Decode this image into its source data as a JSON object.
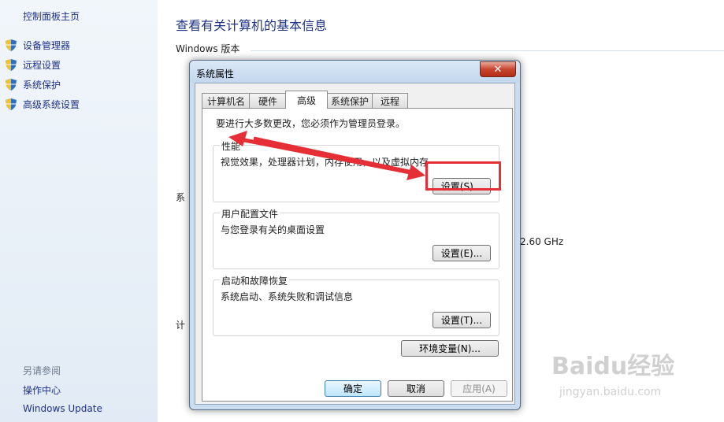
{
  "nav": {
    "home": "控制面板主页",
    "items": [
      {
        "label": "设备管理器"
      },
      {
        "label": "远程设置"
      },
      {
        "label": "系统保护"
      },
      {
        "label": "高级系统设置"
      }
    ],
    "see_also": "另请参阅",
    "links": [
      "操作中心",
      "Windows Update"
    ]
  },
  "main": {
    "title": "查看有关计算机的基本信息",
    "windows_version_heading": "Windows 版本",
    "peek_xi": "系",
    "peek_ji": "计",
    "peek_ghz": "2.60 GHz"
  },
  "dialog": {
    "title": "系统属性",
    "close": "✕",
    "tabs": [
      "计算机名",
      "硬件",
      "高级",
      "系统保护",
      "远程"
    ],
    "active_tab": "高级",
    "notice": "要进行大多数更改，您必须作为管理员登录。",
    "groups": [
      {
        "label": "性能",
        "desc": "视觉效果，处理器计划，内存使用，以及虚拟内存",
        "button": "设置(S)..."
      },
      {
        "label": "用户配置文件",
        "desc": "与您登录有关的桌面设置",
        "button": "设置(E)..."
      },
      {
        "label": "启动和故障恢复",
        "desc": "系统启动、系统失败和调试信息",
        "button": "设置(T)..."
      }
    ],
    "env_button": "环境变量(N)...",
    "ok": "确定",
    "cancel": "取消",
    "apply": "应用(A)"
  },
  "annotation": {
    "color": "#e52e35"
  },
  "watermark": {
    "logo": "Baidu经验",
    "url": "jingyan.baidu.com"
  },
  "colors": {
    "link": "#1e3287",
    "accent_red": "#e52e35"
  }
}
